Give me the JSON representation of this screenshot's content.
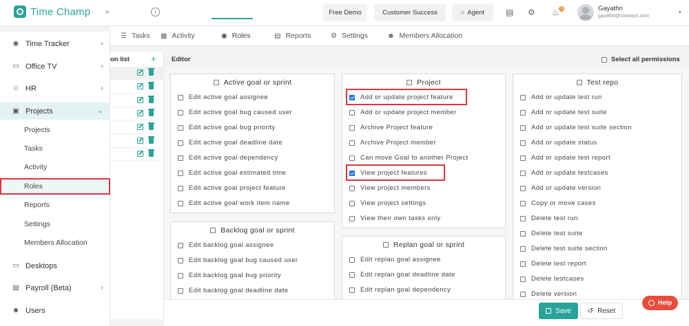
{
  "header": {
    "brand": "Time Champ",
    "collapse_glyph": "»",
    "info_glyph": "i",
    "buttons": [
      "Free Demo",
      "Customer Success",
      "Agent"
    ],
    "notification_count": "1",
    "user_name": "Gayathri",
    "user_email": "gayathri@sriwasys.com"
  },
  "sidebar": {
    "items": [
      {
        "label": "Time Tracker",
        "icon": "globe-icon"
      },
      {
        "label": "Office TV",
        "icon": "tv-icon"
      },
      {
        "label": "HR",
        "icon": "person-icon"
      },
      {
        "label": "Projects",
        "icon": "folder-icon"
      }
    ],
    "project_subitems": [
      "Projects",
      "Tasks",
      "Activity",
      "Roles",
      "Reports",
      "Settings",
      "Members Allocation"
    ],
    "selected_subitem": "Roles",
    "bottom_items": [
      {
        "label": "Desktops",
        "icon": "monitor-icon"
      },
      {
        "label": "Payroll (Beta)",
        "icon": "wallet-icon"
      },
      {
        "label": "Users",
        "icon": "users-icon"
      }
    ]
  },
  "tabs": [
    "Tasks",
    "Activity",
    "Roles",
    "Reports",
    "Settings",
    "Members Allocation"
  ],
  "active_tab": "Roles",
  "role_list": {
    "title": "on list",
    "add_glyph": "+"
  },
  "editor": {
    "title": "Editor",
    "select_all_label": "Select all permissions",
    "cards": {
      "active_goal": {
        "title": "Active goal or sprint",
        "items": [
          "Edit active goal assignee",
          "Edit active goal bug caused user",
          "Edit active goal bug priority",
          "Edit active goal deadline date",
          "Edit active goal dependency",
          "Edit active goal estimated time",
          "Edit active goal project feature",
          "Edit active goal work item name"
        ]
      },
      "backlog_goal": {
        "title": "Backlog goal or sprint",
        "items": [
          "Edit backlog goal assignee",
          "Edit backlog goal bug caused user",
          "Edit backlog goal bug priority",
          "Edit backlog goal deadline date"
        ]
      },
      "project": {
        "title": "Project",
        "items": [
          "Add or update project feature",
          "Add or update project member",
          "Archive Project feature",
          "Archive Project member",
          "Can move Goal to another Project",
          "View project features",
          "View project members",
          "View project settings",
          "View their own tasks only"
        ],
        "checked": [
          true,
          false,
          false,
          false,
          false,
          true,
          false,
          false,
          false
        ]
      },
      "replan_goal": {
        "title": "Replan goal or sprint",
        "items": [
          "Edit replan goal assignee",
          "Edit replan goal deadline date",
          "Edit replan goal dependency"
        ]
      },
      "test_repo": {
        "title": "Test repo",
        "items": [
          "Add or update test run",
          "Add or update test suite",
          "Add or update test suite section",
          "Add or update status",
          "Add or update test report",
          "Add or update testcases",
          "Add or update version",
          "Copy or move cases",
          "Delete test run",
          "Delete test suite",
          "Delete test suite section",
          "Delete test report",
          "Delete testcases",
          "Delete version"
        ]
      }
    }
  },
  "footer": {
    "save_label": "Save",
    "reset_label": "Reset",
    "help_label": "Help"
  },
  "colors": {
    "accent": "#2aa39a",
    "highlight": "#d8363f",
    "checkbox_checked": "#1a73e8",
    "help": "#e74c3c"
  }
}
